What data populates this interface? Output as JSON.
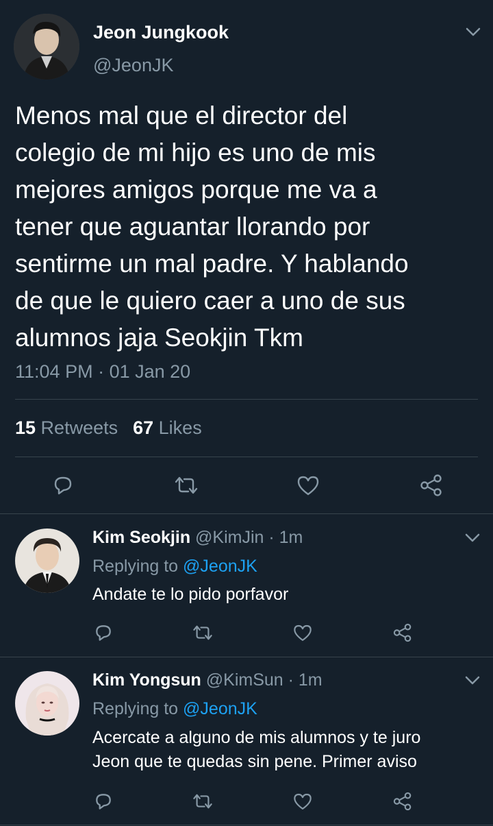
{
  "main_tweet": {
    "author_name": "Jeon Jungkook",
    "author_handle": "@JeonJK",
    "text": "Menos mal que el director del\ncolegio de mi hijo es uno de mis\nmejores amigos porque me va a\ntener que aguantar llorando por\nsentirme un mal padre. Y hablando\nde que le quiero caer a uno de sus\nalumnos jaja Seokjin Tkm",
    "time": "11:04 PM",
    "separator": " · ",
    "date": "01 Jan 20",
    "retweets_count": "15",
    "retweets_label": " Retweets",
    "likes_count": "67",
    "likes_label": " Likes"
  },
  "replies": [
    {
      "author_name": "Kim Seokjin",
      "author_handle": "@KimJin",
      "age": " · 1m",
      "replying_prefix": "Replying to ",
      "replying_to": "@JeonJK",
      "text": "Andate te lo pido porfavor"
    },
    {
      "author_name": "Kim Yongsun",
      "author_handle": "@KimSun",
      "age": " · 1m",
      "replying_prefix": "Replying to ",
      "replying_to": "@JeonJK",
      "text": "Acercate a alguno de mis alumnos y te juro\nJeon que te quedas sin pene. Primer aviso"
    }
  ],
  "icons": [
    "reply-icon",
    "retweet-icon",
    "like-icon",
    "share-icon",
    "chevron-down-icon"
  ],
  "colors": {
    "background": "#15202b",
    "secondary_text": "#8899a6",
    "link": "#1da1f2",
    "divider": "#38444d"
  }
}
